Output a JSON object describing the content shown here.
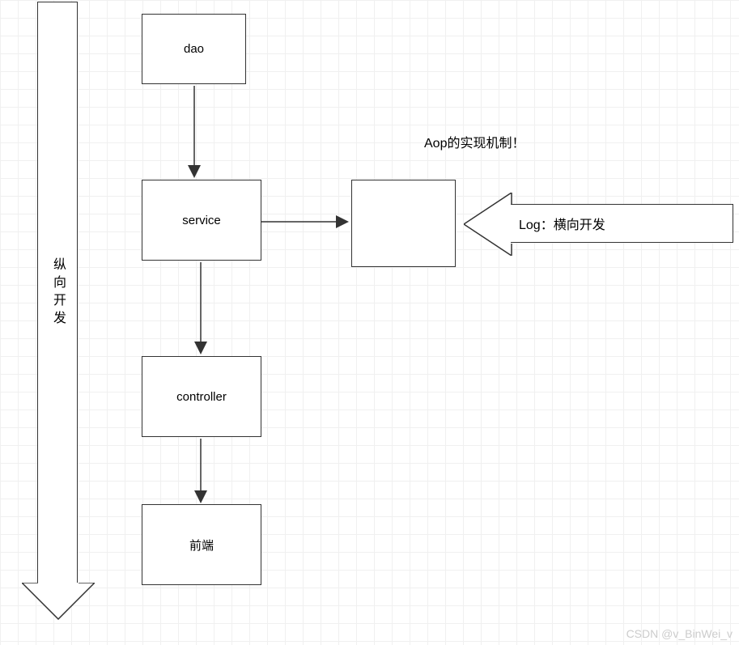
{
  "vertical_arrow_label": "纵向开发",
  "boxes": {
    "dao": "dao",
    "service": "service",
    "controller": "controller",
    "frontend": "前端"
  },
  "annotation_aop": "Aop的实现机制！",
  "log_label": "Log：横向开发",
  "watermark": "CSDN @v_BinWei_v"
}
